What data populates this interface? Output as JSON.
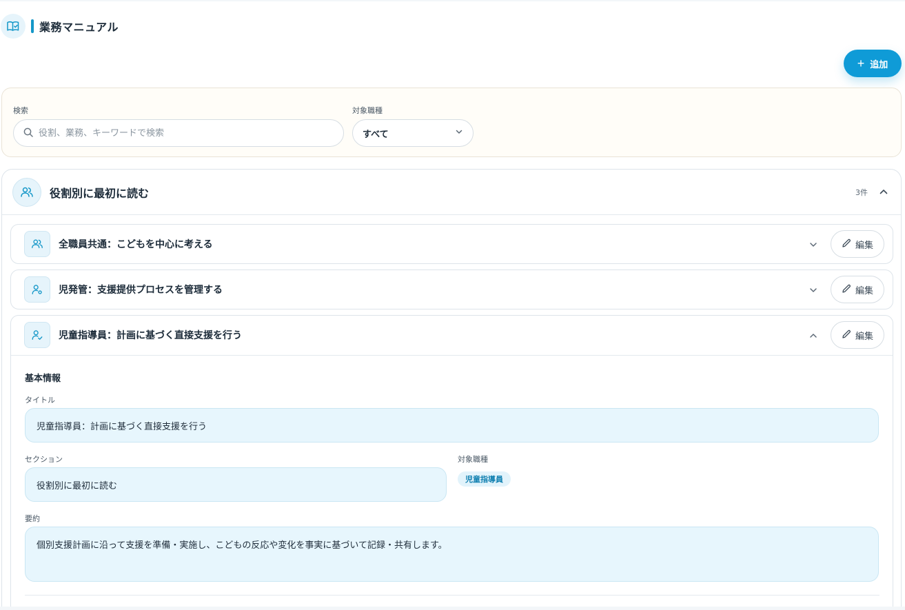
{
  "header": {
    "title": "業務マニュアル",
    "icon": "book-check-icon"
  },
  "toolbar": {
    "add_label": "追加"
  },
  "filters": {
    "search_label": "検索",
    "search_placeholder": "役割、業務、キーワードで検索",
    "search_value": "",
    "job_label": "対象職種",
    "job_selected": "すべて"
  },
  "section": {
    "title": "役割別に最初に読む",
    "count": "3件",
    "expanded": true,
    "items": [
      {
        "title": "全職員共通：こどもを中心に考える",
        "icon": "users-icon",
        "edit_label": "編集",
        "expanded": false
      },
      {
        "title": "児発管：支援提供プロセスを管理する",
        "icon": "user-gear-icon",
        "edit_label": "編集",
        "expanded": false
      },
      {
        "title": "児童指導員：計画に基づく直接支援を行う",
        "icon": "user-check-icon",
        "edit_label": "編集",
        "expanded": true
      }
    ]
  },
  "detail": {
    "heading": "基本情報",
    "title_label": "タイトル",
    "title_value": "児童指導員：計画に基づく直接支援を行う",
    "section_label": "セクション",
    "section_value": "役割別に最初に読む",
    "job_label": "対象職種",
    "job_chip": "児童指導員",
    "summary_label": "要約",
    "summary_value": "個別支援計画に沿って支援を準備・実施し、こどもの反応や変化を事実に基づいて記録・共有します。"
  },
  "colors": {
    "accent": "#0f9bd7",
    "icon_bg": "#e6f4fb",
    "field_bg": "#e7f6fd",
    "filter_bg": "#fffdf8"
  }
}
